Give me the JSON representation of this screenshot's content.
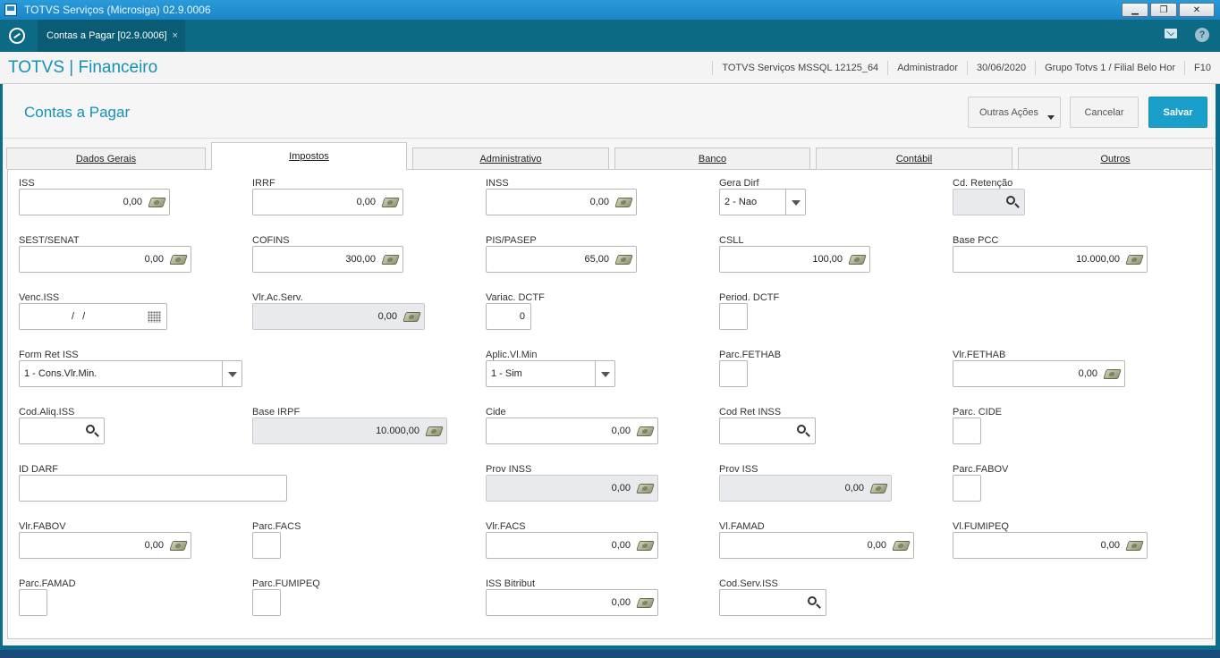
{
  "window": {
    "title": "TOTVS Serviços (Microsiga) 02.9.0006"
  },
  "appbar": {
    "tab_label": "Contas a Pagar [02.9.0006]",
    "tab_close": "×",
    "help_label": "?"
  },
  "module": {
    "title": "TOTVS | Financeiro",
    "env": "TOTVS Serviços MSSQL 12125_64",
    "user": "Administrador",
    "date": "30/06/2020",
    "branch": "Grupo Totvs 1 / Filial Belo Hor",
    "shortcut": "F10"
  },
  "page": {
    "title": "Contas a Pagar"
  },
  "actions": {
    "more": "Outras Ações",
    "cancel": "Cancelar",
    "save": "Salvar"
  },
  "tabs": [
    "Dados Gerais",
    "Impostos",
    "Administrativo",
    "Banco",
    "Contábil",
    "Outros"
  ],
  "active_tab": "Impostos",
  "fields": {
    "iss": {
      "label": "ISS",
      "value": "0,00"
    },
    "irrf": {
      "label": "IRRF",
      "value": "0,00"
    },
    "inss": {
      "label": "INSS",
      "value": "0,00"
    },
    "gera_dirf": {
      "label": "Gera Dirf",
      "value": "2 - Nao"
    },
    "cd_retencao": {
      "label": "Cd. Retenção",
      "value": ""
    },
    "sest_senat": {
      "label": "SEST/SENAT",
      "value": "0,00"
    },
    "cofins": {
      "label": "COFINS",
      "value": "300,00"
    },
    "pis_pasep": {
      "label": "PIS/PASEP",
      "value": "65,00"
    },
    "csll": {
      "label": "CSLL",
      "value": "100,00"
    },
    "base_pcc": {
      "label": "Base PCC",
      "value": "10.000,00"
    },
    "venc_iss": {
      "label": "Venc.ISS",
      "value": "/ /"
    },
    "vlr_ac_serv": {
      "label": "Vlr.Ac.Serv.",
      "value": "0,00"
    },
    "variac_dctf": {
      "label": "Variac. DCTF",
      "value": "0"
    },
    "period_dctf": {
      "label": "Period. DCTF",
      "value": ""
    },
    "form_ret_iss": {
      "label": "Form Ret ISS",
      "value": "1 - Cons.Vlr.Min."
    },
    "aplic_vl_min": {
      "label": "Aplic.Vl.Min",
      "value": "1 - Sim"
    },
    "parc_fethab": {
      "label": "Parc.FETHAB",
      "value": ""
    },
    "vlr_fethab": {
      "label": "Vlr.FETHAB",
      "value": "0,00"
    },
    "cod_aliq_iss": {
      "label": "Cod.Aliq.ISS",
      "value": ""
    },
    "base_irpf": {
      "label": "Base IRPF",
      "value": "10.000,00"
    },
    "cide": {
      "label": "Cide",
      "value": "0,00"
    },
    "cod_ret_inss": {
      "label": "Cod Ret INSS",
      "value": ""
    },
    "parc_cide": {
      "label": "Parc. CIDE",
      "value": ""
    },
    "id_darf": {
      "label": "ID DARF",
      "value": ""
    },
    "prov_inss": {
      "label": "Prov INSS",
      "value": "0,00"
    },
    "prov_iss": {
      "label": "Prov ISS",
      "value": "0,00"
    },
    "parc_fabov": {
      "label": "Parc.FABOV",
      "value": ""
    },
    "vlr_fabov": {
      "label": "Vlr.FABOV",
      "value": "0,00"
    },
    "parc_facs": {
      "label": "Parc.FACS",
      "value": ""
    },
    "vlr_facs": {
      "label": "Vlr.FACS",
      "value": "0,00"
    },
    "vl_famad": {
      "label": "Vl.FAMAD",
      "value": "0,00"
    },
    "vl_fumipeq": {
      "label": "Vl.FUMIPEQ",
      "value": "0,00"
    },
    "parc_famad": {
      "label": "Parc.FAMAD",
      "value": ""
    },
    "parc_fumipeq": {
      "label": "Parc.FUMIPEQ",
      "value": ""
    },
    "iss_bitribut": {
      "label": "ISS Bitribut",
      "value": "0,00"
    },
    "cod_serv_iss": {
      "label": "Cod.Serv.ISS",
      "value": ""
    }
  }
}
